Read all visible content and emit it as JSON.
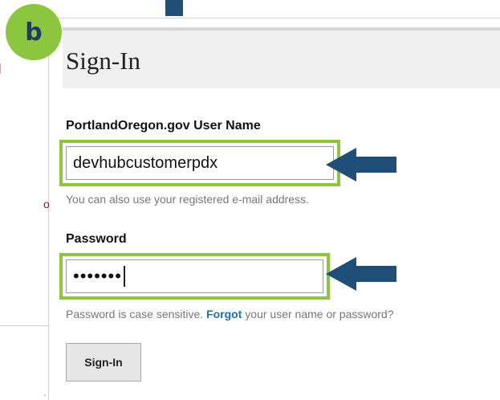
{
  "badge": {
    "letter": "b"
  },
  "left_fragments": {
    "p_letter": "o"
  },
  "header": {
    "title": "Sign-In"
  },
  "form": {
    "username_label": "PortlandOregon.gov User Name",
    "username_value": "devhubcustomerpdx",
    "username_hint": "You can also use your registered e-mail address.",
    "password_label": "Password",
    "password_value": "•••••••",
    "password_hint_before": "Password is case sensitive. ",
    "password_hint_link": "Forgot",
    "password_hint_after": " your user name or password?",
    "submit_label": "Sign-In"
  },
  "colors": {
    "highlight_green": "#8cc63f",
    "arrow_blue": "#1f4e79",
    "link_blue": "#1a6fb5"
  },
  "icons": {
    "callout_arrow": "arrow-left-icon"
  }
}
